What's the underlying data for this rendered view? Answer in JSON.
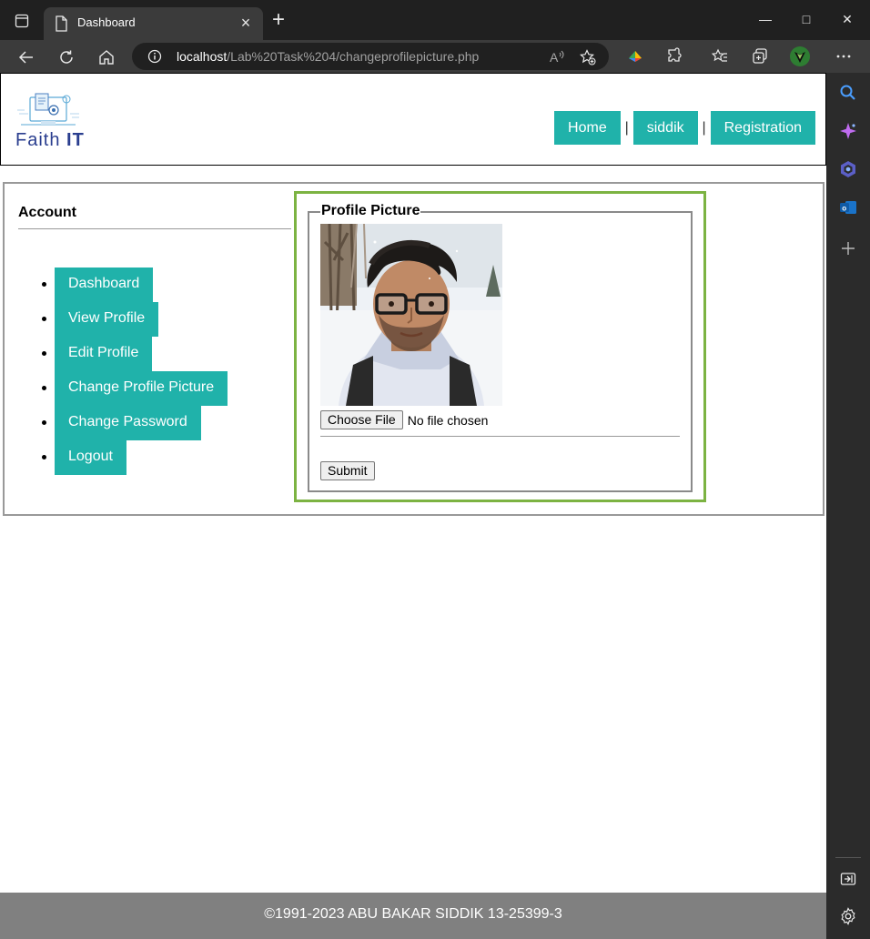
{
  "browser": {
    "tab_title": "Dashboard",
    "url_host": "localhost",
    "url_path": "/Lab%20Task%204/changeprofilepicture.php",
    "window_buttons": {
      "minimize": "—",
      "maximize": "□",
      "close": "✕"
    }
  },
  "header": {
    "logo_word": "Faith",
    "logo_bold": "IT",
    "nav": [
      {
        "label": "Home"
      },
      {
        "label": "siddik"
      },
      {
        "label": "Registration"
      }
    ],
    "separator": "|"
  },
  "sidebar": {
    "title": "Account",
    "items": [
      {
        "label": "Dashboard"
      },
      {
        "label": "View Profile"
      },
      {
        "label": "Edit Profile"
      },
      {
        "label": "Change Profile Picture"
      },
      {
        "label": "Change Password"
      },
      {
        "label": "Logout"
      }
    ]
  },
  "form": {
    "legend": "Profile Picture",
    "choose_file_label": "Choose File",
    "file_status": "No file chosen",
    "submit_label": "Submit"
  },
  "footer": {
    "text": "©1991-2023 ABU BAKAR SIDDIK 13-25399-3"
  },
  "colors": {
    "accent": "#20b2aa",
    "focus_outline": "#7cb342",
    "footer_bg": "#808080",
    "logo_blue": "#2a3e8f"
  }
}
